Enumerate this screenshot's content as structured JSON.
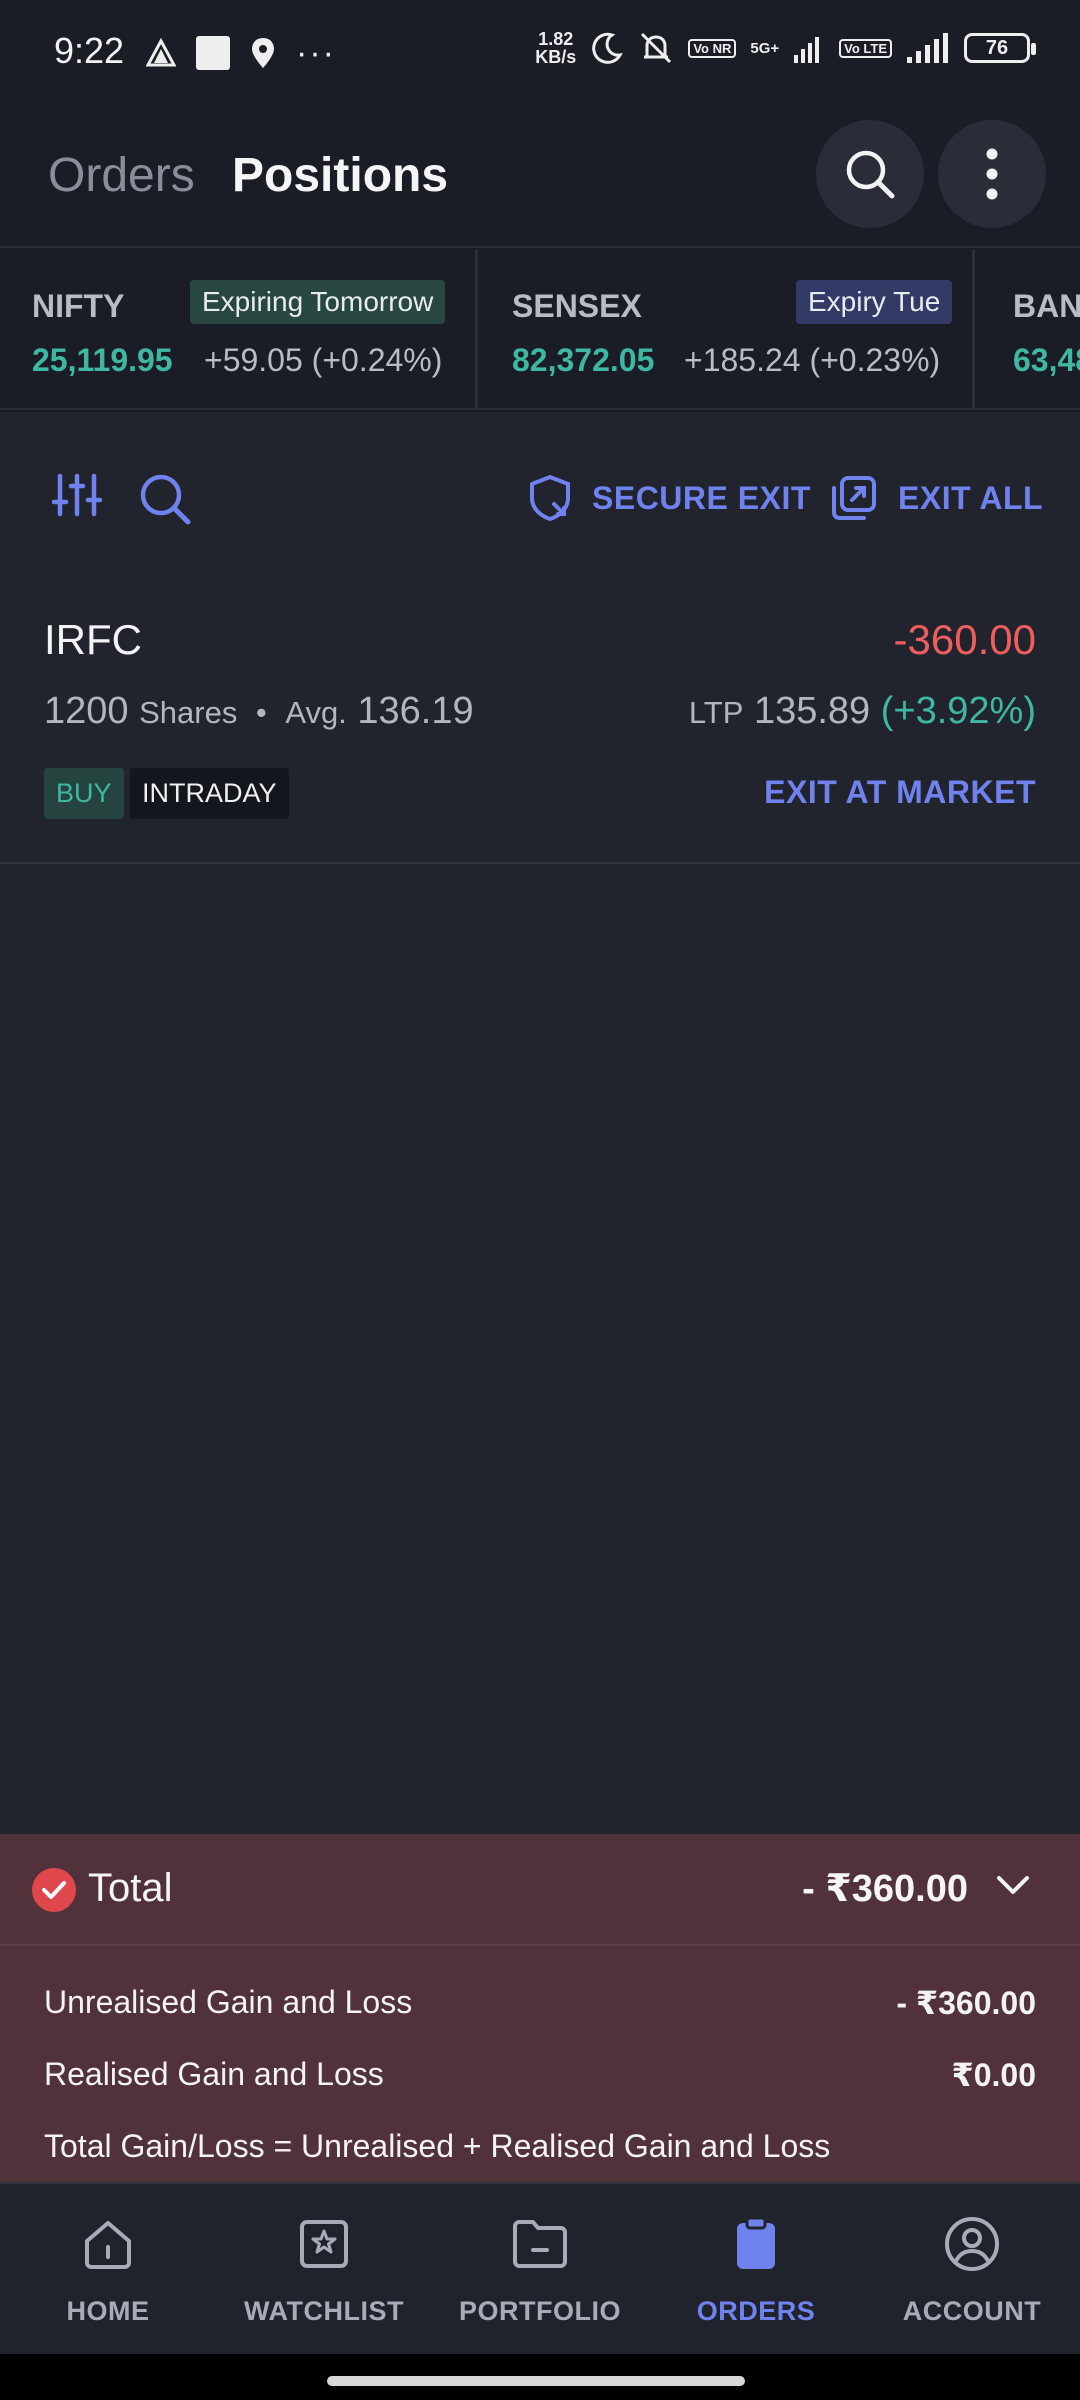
{
  "status_bar": {
    "time": "9:22",
    "net_speed_value": "1.82",
    "net_speed_unit": "KB/s",
    "sim1_tag": "Vo NR",
    "network_type": "5G+",
    "sim2_tag": "Vo LTE",
    "battery": "76"
  },
  "header": {
    "tab_orders": "Orders",
    "tab_positions": "Positions",
    "active_tab": "Positions"
  },
  "indices": [
    {
      "name": "NIFTY",
      "badge": "Expiring Tomorrow",
      "value": "25,119.95",
      "change": "+59.05 (+0.24%)"
    },
    {
      "name": "SENSEX",
      "badge": "Expiry Tue",
      "value": "82,372.05",
      "change": "+185.24 (+0.23%)"
    },
    {
      "name": "BAN",
      "value": "63,48"
    }
  ],
  "toolbar": {
    "secure_exit": "SECURE EXIT",
    "exit_all": "EXIT ALL"
  },
  "position": {
    "symbol": "IRFC",
    "pnl": "-360.00",
    "qty": "1200",
    "qty_unit": "Shares",
    "separator": "•",
    "avg_label": "Avg.",
    "avg": "136.19",
    "ltp_label": "LTP",
    "ltp": "135.89",
    "ltp_change": "(+3.92%)",
    "side": "BUY",
    "product": "INTRADAY",
    "exit_label": "EXIT AT MARKET"
  },
  "totals": {
    "label": "Total",
    "value": "- ₹360.00",
    "unrealised_label": "Unrealised Gain and Loss",
    "unrealised_value": "- ₹360.00",
    "realised_label": "Realised Gain and Loss",
    "realised_value": "₹0.00",
    "formula": "Total Gain/Loss = Unrealised + Realised Gain and Loss"
  },
  "nav": {
    "items": [
      {
        "label": "HOME",
        "icon": "home-icon"
      },
      {
        "label": "WATCHLIST",
        "icon": "watchlist-icon"
      },
      {
        "label": "PORTFOLIO",
        "icon": "portfolio-icon"
      },
      {
        "label": "ORDERS",
        "icon": "orders-icon"
      },
      {
        "label": "ACCOUNT",
        "icon": "account-icon"
      }
    ],
    "active": "ORDERS"
  },
  "colors": {
    "accent": "#6f82ee",
    "positive": "#3fb8a3",
    "negative": "#ef5e5e",
    "loss_panel": "#51313a",
    "background": "#21232d"
  }
}
